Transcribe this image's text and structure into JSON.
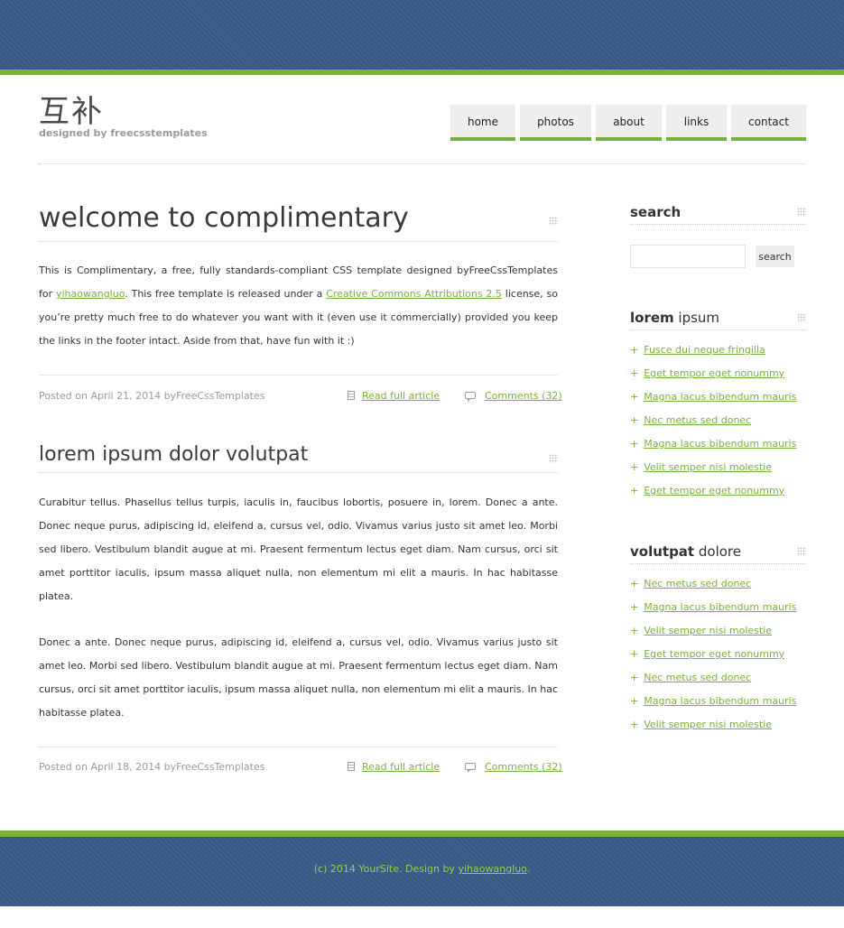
{
  "header": {
    "logo_title": "互补",
    "logo_subtitle": "designed by freecsstemplates"
  },
  "nav": {
    "items": [
      {
        "label": "home"
      },
      {
        "label": "photos"
      },
      {
        "label": "about"
      },
      {
        "label": "links"
      },
      {
        "label": "contact"
      }
    ]
  },
  "posts": [
    {
      "title": "welcome to complimentary",
      "body_intro": "This is Complimentary, a free, fully standards-compliant CSS template designed byFreeCssTemplates for ",
      "body_link1": "yihaowangluo",
      "body_mid": ". This free template is released under a ",
      "body_link2": "Creative Commons Attributions 2.5",
      "body_end": " license, so you’re pretty much free to do whatever you want with it (even use it commercially) provided you keep the links in the footer intact. Aside from that, have fun with it :)",
      "posted": "Posted on April 21, 2014 byFreeCssTemplates",
      "read_more": "Read full article",
      "comments": "Comments (32)"
    },
    {
      "title": "lorem ipsum dolor volutpat",
      "paragraph1": "Curabitur tellus. Phasellus tellus turpis, iaculis in, faucibus lobortis, posuere in, lorem. Donec a ante. Donec neque purus, adipiscing id, eleifend a, cursus vel, odio. Vivamus varius justo sit amet leo. Morbi sed libero. Vestibulum blandit augue at mi. Praesent fermentum lectus eget diam. Nam cursus, orci sit amet porttitor iaculis, ipsum massa aliquet nulla, non elementum mi elit a mauris. In hac habitasse platea.",
      "paragraph2": "Donec a ante. Donec neque purus, adipiscing id, eleifend a, cursus vel, odio. Vivamus varius justo sit amet leo. Morbi sed libero. Vestibulum blandit augue at mi. Praesent fermentum lectus eget diam. Nam cursus, orci sit amet porttitor iaculis, ipsum massa aliquet nulla, non elementum mi elit a mauris. In hac habitasse platea.",
      "posted": "Posted on April 18, 2014 byFreeCssTemplates",
      "read_more": "Read full article",
      "comments": "Comments (32)"
    }
  ],
  "sidebar": {
    "search": {
      "title": "search",
      "input_value": "",
      "button_label": "search"
    },
    "lorem": {
      "title_bold": "lorem",
      "title_rest": " ipsum",
      "links": [
        "Fusce dui neque fringilla",
        "Eget tempor eget nonummy",
        "Magna lacus bibendum mauris",
        "Nec metus sed donec",
        "Magna lacus bibendum mauris",
        "Velit semper nisi molestie",
        "Eget tempor eget nonummy"
      ]
    },
    "volutpat": {
      "title_bold": "volutpat",
      "title_rest": " dolore",
      "links": [
        "Nec metus sed donec",
        "Magna lacus bibendum mauris",
        "Velit semper nisi molestie",
        "Eget tempor eget nonummy",
        "Nec metus sed donec",
        "Magna lacus bibendum mauris",
        "Velit semper nisi molestie"
      ]
    }
  },
  "footer": {
    "text_before": "(c) 2014 YourSite. Design by ",
    "link": "yihaowangluo",
    "text_after": "."
  },
  "colors": {
    "band_blue": "#3a5a86",
    "accent_green": "#7ab03e",
    "footer_text_green": "#8fd04a"
  }
}
